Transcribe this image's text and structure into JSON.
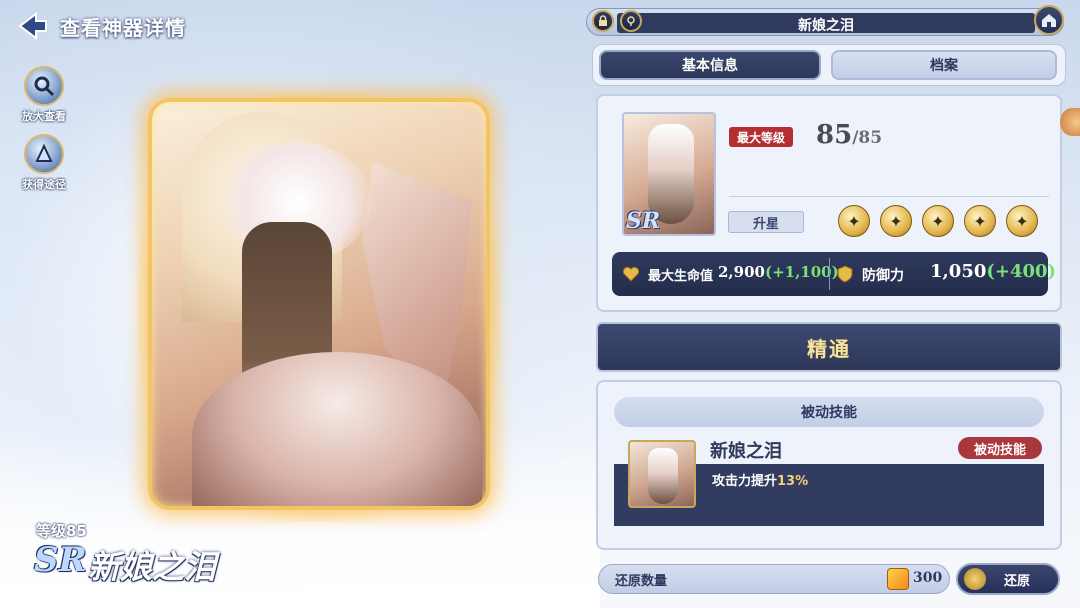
{
  "header": {
    "title": "查看神器详情"
  },
  "side_buttons": [
    {
      "label": "放大查看",
      "icon": "magnifier-icon"
    },
    {
      "label": "获得途径",
      "icon": "source-icon"
    }
  ],
  "artifact": {
    "level_text": "等级85",
    "rarity": "SR",
    "name": "新娘之泪"
  },
  "panel": {
    "title": "新娘之泪",
    "tabs": [
      {
        "label": "基本信息",
        "active": true
      },
      {
        "label": "档案",
        "active": false
      }
    ],
    "thumb_rarity": "SR",
    "max_level_badge": "最大等级",
    "level_current": "85",
    "level_max": "/85",
    "star_up_label": "升星",
    "stars": 5,
    "stats": {
      "hp_label": "最大生命值",
      "hp_value": "2,900",
      "hp_bonus": "(+1,100)",
      "def_label": "防御力",
      "def_value": "1,050",
      "def_bonus": "(+400)"
    },
    "mastery_label": "精通",
    "skill_section_title": "被动技能",
    "skill": {
      "name": "新娘之泪",
      "badge": "被动技能",
      "desc_prefix": "攻击力提升",
      "desc_value": "13%"
    },
    "restore_label": "还原数量",
    "restore_count": "300",
    "restore_button": "还原"
  },
  "colors": {
    "accent_gold": "#f1c464",
    "panel_dark": "#2f3a5e",
    "badge_red": "#b52f32",
    "bonus_green": "#79e278"
  }
}
